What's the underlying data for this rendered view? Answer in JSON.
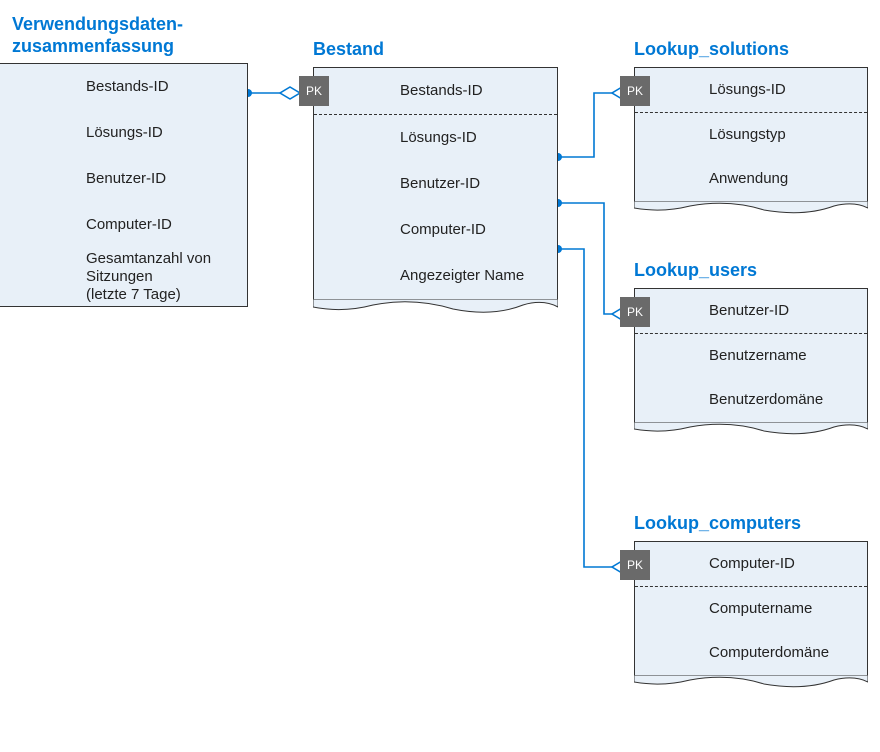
{
  "entities": {
    "usage": {
      "title": "Verwendungsdaten-\nzusammenfassung",
      "fields": {
        "f1": "Bestands-ID",
        "f2": "Lösungs-ID",
        "f3": "Benutzer-ID",
        "f4": "Computer-ID",
        "f5": "Gesamtanzahl von Sitzungen\n(letzte 7 Tage)"
      }
    },
    "bestand": {
      "title": "Bestand",
      "pk": "PK",
      "fields": {
        "f1": "Bestands-ID",
        "f2": "Lösungs-ID",
        "f3": "Benutzer-ID",
        "f4": "Computer-ID",
        "f5": "Angezeigter Name"
      }
    },
    "solutions": {
      "title": "Lookup_solutions",
      "pk": "PK",
      "fields": {
        "f1": "Lösungs-ID",
        "f2": "Lösungstyp",
        "f3": "Anwendung"
      }
    },
    "users": {
      "title": "Lookup_users",
      "pk": "PK",
      "fields": {
        "f1": "Benutzer-ID",
        "f2": "Benutzername",
        "f3": "Benutzerdomäne"
      }
    },
    "computers": {
      "title": "Lookup_computers",
      "pk": "PK",
      "fields": {
        "f1": "Computer-ID",
        "f2": "Computername",
        "f3": "Computerdomäne"
      }
    }
  },
  "relationships": [
    {
      "from": "usage.Bestands-ID",
      "to": "bestand.Bestands-ID",
      "type": "one-to-many"
    },
    {
      "from": "bestand.Lösungs-ID",
      "to": "solutions.Lösungs-ID",
      "type": "many-to-one"
    },
    {
      "from": "bestand.Benutzer-ID",
      "to": "users.Benutzer-ID",
      "type": "many-to-one"
    },
    {
      "from": "bestand.Computer-ID",
      "to": "computers.Computer-ID",
      "type": "many-to-one"
    }
  ]
}
